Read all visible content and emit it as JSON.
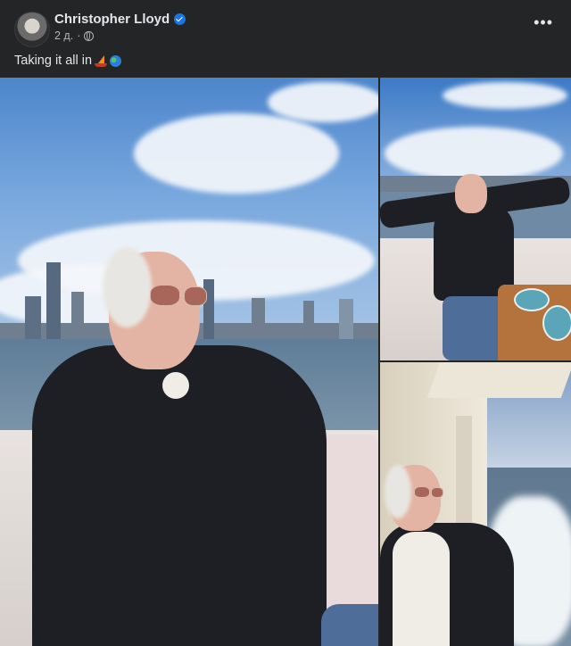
{
  "post": {
    "author_name": "Christopher Lloyd",
    "timestamp": "2 д.",
    "caption": "Taking it all in",
    "caption_emojis": [
      "sailboat-emoji",
      "globe-emoji"
    ],
    "more_button": "•••"
  },
  "photos": [
    {
      "subject": "man-on-boat-city-skyline"
    },
    {
      "subject": "man-on-boat-arms-outstretched"
    },
    {
      "subject": "man-on-boat-open-water"
    }
  ],
  "colors": {
    "background": "#242526",
    "text_primary": "#e4e6eb",
    "text_secondary": "#b0b3b8",
    "verified_badge": "#1b74e4"
  }
}
